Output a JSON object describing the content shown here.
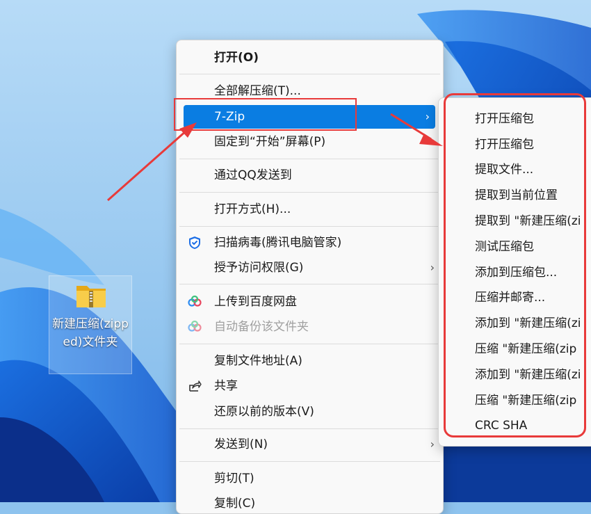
{
  "desktop": {
    "folder_icon": "zip-folder-icon",
    "folder_label": "新建压缩(zipped)文件夹"
  },
  "context_menu": {
    "open": "打开(O)",
    "extract_all": "全部解压缩(T)...",
    "seven_zip": "7-Zip",
    "pin_start": "固定到“开始”屏幕(P)",
    "send_qq": "通过QQ发送到",
    "open_with": "打开方式(H)...",
    "scan_virus": "扫描病毒(腾讯电脑管家)",
    "grant_access": "授予访问权限(G)",
    "upload_baidu": "上传到百度网盘",
    "auto_backup": "自动备份该文件夹",
    "copy_path": "复制文件地址(A)",
    "share": "共享",
    "restore": "还原以前的版本(V)",
    "send_to": "发送到(N)",
    "cut": "剪切(T)",
    "copy": "复制(C)"
  },
  "submenu": {
    "items": [
      "打开压缩包",
      "打开压缩包",
      "提取文件...",
      "提取到当前位置",
      "提取到 \"新建压缩(zi",
      "测试压缩包",
      "添加到压缩包...",
      "压缩并邮寄...",
      "添加到 \"新建压缩(zi",
      "压缩 \"新建压缩(zip",
      "添加到 \"新建压缩(zi",
      "压缩 \"新建压缩(zip",
      "CRC SHA"
    ]
  },
  "colors": {
    "highlight": "#0a7de2",
    "annotation": "#e83a3a",
    "wallpaper": "#8ec3ee"
  }
}
